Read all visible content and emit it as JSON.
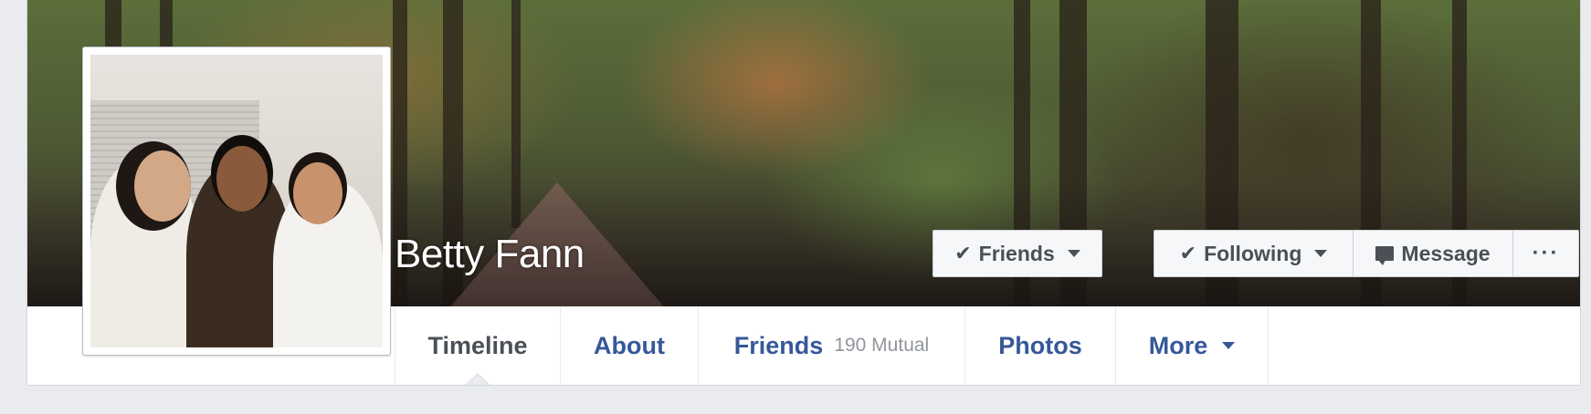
{
  "profile": {
    "name": "Betty Fann"
  },
  "cover_actions": {
    "friends_label": "Friends",
    "following_label": "Following",
    "message_label": "Message",
    "more_label": "···"
  },
  "nav": {
    "timeline": "Timeline",
    "about": "About",
    "friends": "Friends",
    "friends_count": "190 Mutual",
    "photos": "Photos",
    "more": "More"
  },
  "icons": {
    "check": "check-icon",
    "caret": "caret-down-icon",
    "message": "message-icon",
    "ellipsis": "ellipsis-icon"
  },
  "colors": {
    "link_blue": "#365899",
    "active_text": "#4b4f56",
    "page_bg": "#e9ebee"
  }
}
